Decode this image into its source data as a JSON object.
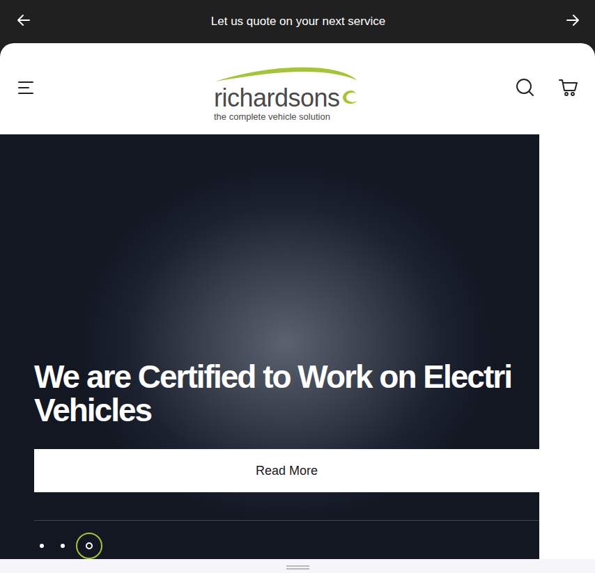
{
  "announcement": {
    "text": "Let us quote on your next service"
  },
  "logo": {
    "name": "richardsons",
    "tagline": "the complete vehicle solution"
  },
  "hero": {
    "heading": [
      "We are Certified to Work on Electri",
      "Vehicles"
    ],
    "button": "Read More"
  },
  "slides": [
    {
      "selected": false
    },
    {
      "selected": false
    },
    {
      "selected": true
    }
  ]
}
